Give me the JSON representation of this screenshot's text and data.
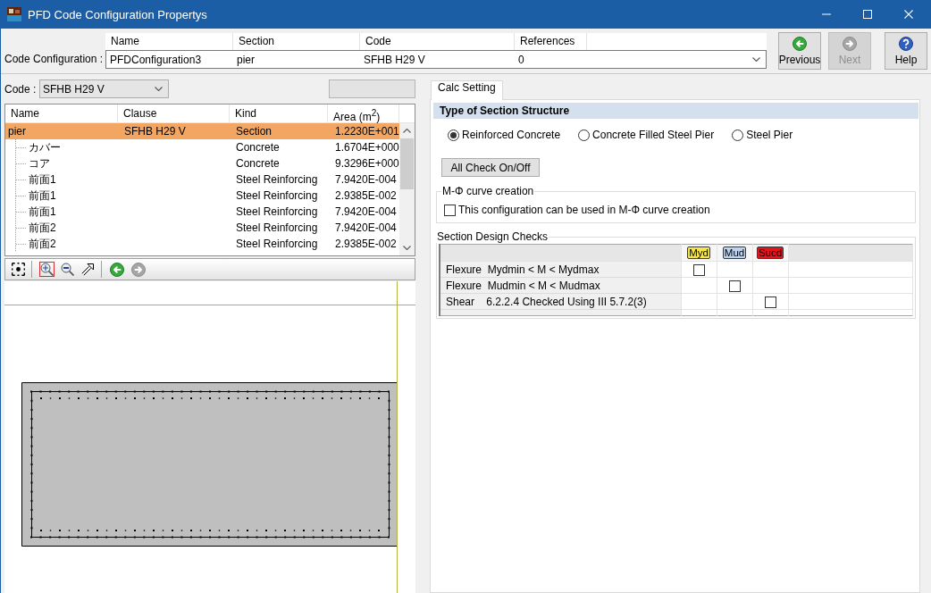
{
  "window": {
    "title": "PFD Code Configuration Propertys"
  },
  "code_configuration": {
    "label": "Code Configuration :",
    "columns": [
      "Name",
      "Section",
      "Code",
      "References"
    ],
    "values": [
      "PFDConfiguration3",
      "pier",
      "SFHB H29 V",
      "0"
    ]
  },
  "nav_buttons": [
    {
      "kind": "previous",
      "label": "Previous",
      "disabled": false
    },
    {
      "kind": "next",
      "label": "Next",
      "disabled": true
    },
    {
      "kind": "help",
      "label": "Help",
      "disabled": false
    }
  ],
  "left_panel": {
    "code_label": "Code :",
    "code_value": "SFHB H29 V",
    "tree": {
      "columns": [
        "Name",
        "Clause",
        "Kind",
        "Area (m$^{2}$)"
      ],
      "rows": [
        {
          "name": "pier",
          "clause": "SFHB H29 V",
          "kind": "Section",
          "area": "1.2230E+001",
          "selected": true,
          "children": [
            {
              "name": "カバー",
              "kind": "Concrete",
              "area": "1.6704E+000",
              "selected": false
            },
            {
              "name": "コア",
              "kind": "Concrete",
              "area": "9.3296E+000",
              "selected": false
            },
            {
              "name": "前面1",
              "kind": "Steel Reinforcing",
              "area": "7.9420E-004",
              "selected": false
            },
            {
              "name": "前面1",
              "kind": "Steel Reinforcing",
              "area": "2.9385E-002",
              "selected": false
            },
            {
              "name": "前面1",
              "kind": "Steel Reinforcing",
              "area": "7.9420E-004",
              "selected": false
            },
            {
              "name": "前面2",
              "kind": "Steel Reinforcing",
              "area": "7.9420E-004",
              "selected": false
            },
            {
              "name": "前面2",
              "kind": "Steel Reinforcing",
              "area": "2.9385E-002",
              "selected": false
            }
          ]
        }
      ]
    },
    "toolbar": [
      [
        {
          "kind": "fit",
          "selected": false
        }
      ],
      [
        {
          "kind": "zoom_in",
          "selected": true
        },
        {
          "kind": "zoom_out",
          "selected": false
        },
        {
          "kind": "arrow",
          "selected": false
        }
      ],
      [
        {
          "kind": "back",
          "disabled": false
        },
        {
          "kind": "forward",
          "disabled": true
        }
      ]
    ]
  },
  "right_panel": {
    "tabs": [
      {
        "label": "Calc Setting",
        "selected": true
      }
    ],
    "section_type": {
      "title": "Type of Section Structure",
      "options": [
        {
          "label": "Reinforced Concrete",
          "selected": true
        },
        {
          "label": "Concrete Filled Steel Pier",
          "selected": false
        },
        {
          "label": "Steel Pier",
          "selected": false
        }
      ]
    },
    "all_check_button": "All Check On/Off",
    "m_phi_group": {
      "title": "M-Φ curve creation",
      "checkbox": {
        "label": "This configuration can be used in M-Φ curve creation",
        "checked": false
      }
    },
    "design_checks": {
      "title": "Section Design Checks",
      "columns": [
        {
          "label": "Myd",
          "color": "#f5e44a"
        },
        {
          "label": "Mud",
          "color": "#bcd2f0"
        },
        {
          "label": "Sucd",
          "color": "#e3141e"
        }
      ],
      "rows": [
        {
          "label": "Flexure  Mydmin < M < Mydmax",
          "cells": [
            {
              "kind": "checkbox",
              "checked": false
            },
            {
              "kind": "empty"
            },
            {
              "kind": "empty"
            }
          ]
        },
        {
          "label": "Flexure  Mudmin < M < Mudmax",
          "cells": [
            {
              "kind": "empty"
            },
            {
              "kind": "checkbox",
              "checked": false
            },
            {
              "kind": "empty"
            }
          ]
        },
        {
          "label": "Shear    6.2.2.4 Checked Using III 5.7.2(3)",
          "cells": [
            {
              "kind": "empty"
            },
            {
              "kind": "empty"
            },
            {
              "kind": "checkbox",
              "checked": false
            }
          ]
        }
      ]
    }
  }
}
